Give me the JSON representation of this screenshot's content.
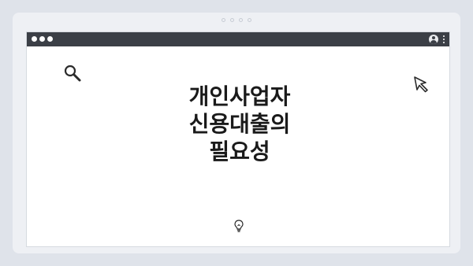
{
  "headline": {
    "lines": [
      "개인사업자",
      "신용대출의",
      "필요성"
    ]
  },
  "icons": {
    "outer": "three-dot-frame-icon",
    "window_controls": "window-dots-icon",
    "user": "user-icon",
    "menu": "kebab-menu-icon",
    "search": "search-icon",
    "cursor": "cursor-icon",
    "idea": "lightbulb-icon"
  },
  "colors": {
    "background": "#dfe3ea",
    "titlebar": "#3b3f46",
    "window": "#ffffff",
    "text": "#1a1a1a"
  }
}
